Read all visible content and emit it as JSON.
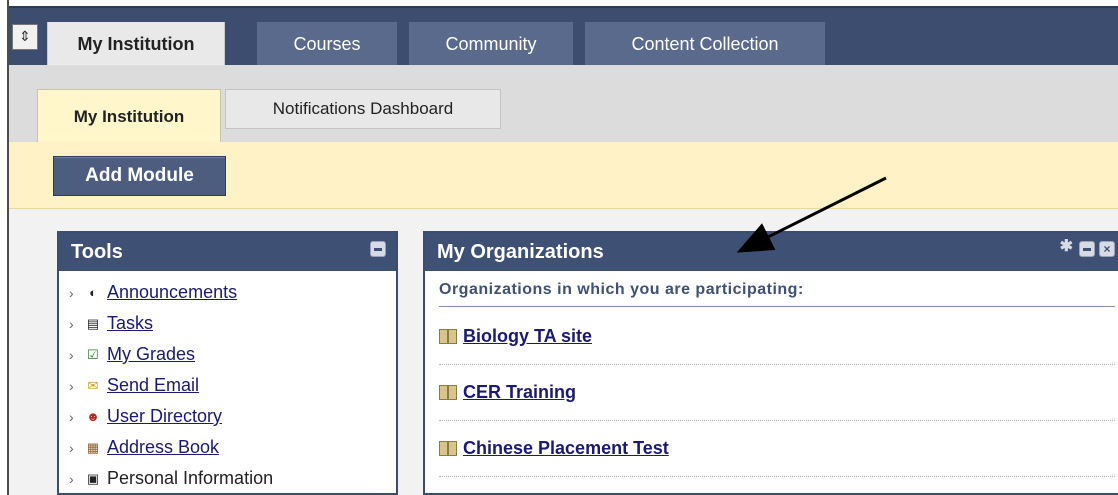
{
  "top_nav": {
    "tabs": [
      {
        "label": "My Institution",
        "active": true
      },
      {
        "label": "Courses",
        "active": false
      },
      {
        "label": "Community",
        "active": false
      },
      {
        "label": "Content Collection",
        "active": false
      }
    ]
  },
  "sub_nav": {
    "tabs": [
      {
        "label": "My Institution",
        "active": true
      },
      {
        "label": "Notifications Dashboard",
        "active": false
      }
    ]
  },
  "module_bar": {
    "add_module_label": "Add Module"
  },
  "tools_module": {
    "title": "Tools",
    "items": [
      {
        "label": "Announcements",
        "icon": "megaphone-icon",
        "link": true
      },
      {
        "label": "Tasks",
        "icon": "clipboard-icon",
        "link": true
      },
      {
        "label": "My Grades",
        "icon": "gradebook-icon",
        "link": true
      },
      {
        "label": "Send Email",
        "icon": "envelope-icon",
        "link": true
      },
      {
        "label": "User Directory",
        "icon": "people-icon",
        "link": true
      },
      {
        "label": "Address Book",
        "icon": "address-book-icon",
        "link": true
      },
      {
        "label": "Personal Information",
        "icon": "person-card-icon",
        "link": false
      }
    ]
  },
  "organizations_module": {
    "title": "My Organizations",
    "subtitle": "Organizations in which you are participating:",
    "items": [
      {
        "label": "Biology TA site"
      },
      {
        "label": "CER Training"
      },
      {
        "label": "Chinese Placement Test"
      }
    ]
  },
  "colors": {
    "nav_dark": "#3d4d6f",
    "module_header": "#3f5075",
    "module_bar_bg": "#fff2c6",
    "link": "#1a1a6e"
  }
}
